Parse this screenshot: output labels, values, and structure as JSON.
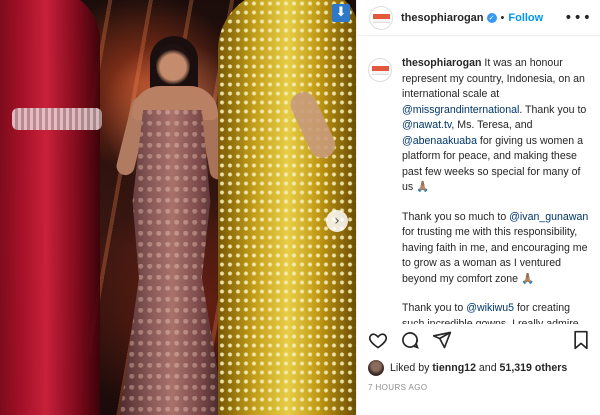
{
  "post": {
    "username": "thesophiarogan",
    "follow_label": "Follow",
    "separator": "•",
    "more_label": "•••",
    "save_badge_label": "⬇",
    "next_label": "›"
  },
  "caption": {
    "username": "thesophiarogan",
    "p1_a": " It was an honour represent my country, Indonesia, on an international scale at ",
    "mention_missgrand": "@missgrandinternational",
    "p1_b": ". Thank you to ",
    "mention_nawat": "@nawat.tv",
    "p1_c": ", Ms. Teresa, and ",
    "mention_abenaa": "@abenaakuaba",
    "p1_d": " for giving us women a platform for peace, and making these past few weeks so special for many of us 🙏🏽",
    "p2_a": "Thank you so much to ",
    "mention_ivan": "@ivan_gunawan",
    "p2_b": " for trusting me with this responsibility, having faith in me, and encouraging me to grow as a woman as I ventured beyond my comfort zone 🙏🏽",
    "p3_a": "Thank you to ",
    "mention_wikiwu": "@wikiwu5",
    "p3_b": " for creating such incredible gowns. I really admire your art, your thought process, and your attention to the finest details 🙏🏽"
  },
  "likes": {
    "prefix": "Liked by ",
    "first_user": "tienng12",
    "middle": " and ",
    "others": "51,319 others"
  },
  "timestamp": "7 HOURS AGO",
  "icons": {
    "heart": "heart-icon",
    "comment": "comment-icon",
    "share": "share-icon",
    "bookmark": "bookmark-icon"
  },
  "colors": {
    "link": "#00376b",
    "follow": "#0095f6",
    "verified": "#3897f0"
  }
}
